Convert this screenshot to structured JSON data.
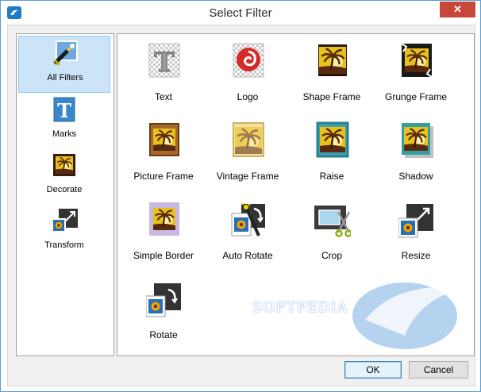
{
  "window": {
    "title": "Select Filter",
    "close_label": "✕"
  },
  "sidebar": {
    "items": [
      {
        "label": "All Filters",
        "icon": "magic-wand-icon",
        "selected": true
      },
      {
        "label": "Marks",
        "icon": "text-mark-icon",
        "selected": false
      },
      {
        "label": "Decorate",
        "icon": "framed-picture-icon",
        "selected": false
      },
      {
        "label": "Transform",
        "icon": "transform-icon",
        "selected": false
      }
    ]
  },
  "filters": [
    {
      "label": "Text",
      "icon": "text-filter-icon"
    },
    {
      "label": "Logo",
      "icon": "logo-filter-icon"
    },
    {
      "label": "Shape Frame",
      "icon": "shape-frame-icon"
    },
    {
      "label": "Grunge Frame",
      "icon": "grunge-frame-icon"
    },
    {
      "label": "Picture Frame",
      "icon": "picture-frame-icon"
    },
    {
      "label": "Vintage Frame",
      "icon": "vintage-frame-icon"
    },
    {
      "label": "Raise",
      "icon": "raise-icon"
    },
    {
      "label": "Shadow",
      "icon": "shadow-icon"
    },
    {
      "label": "Simple Border",
      "icon": "simple-border-icon"
    },
    {
      "label": "Auto Rotate",
      "icon": "auto-rotate-icon"
    },
    {
      "label": "Crop",
      "icon": "crop-icon"
    },
    {
      "label": "Resize",
      "icon": "resize-icon"
    },
    {
      "label": "Rotate",
      "icon": "rotate-icon"
    }
  ],
  "buttons": {
    "ok": "OK",
    "cancel": "Cancel"
  },
  "watermark": {
    "text": "SOFTPEDIA",
    "url": "www.softpedia.com"
  },
  "colors": {
    "selection": "#cce4f7",
    "close": "#c7483a",
    "accent": "#3c7fb1"
  }
}
